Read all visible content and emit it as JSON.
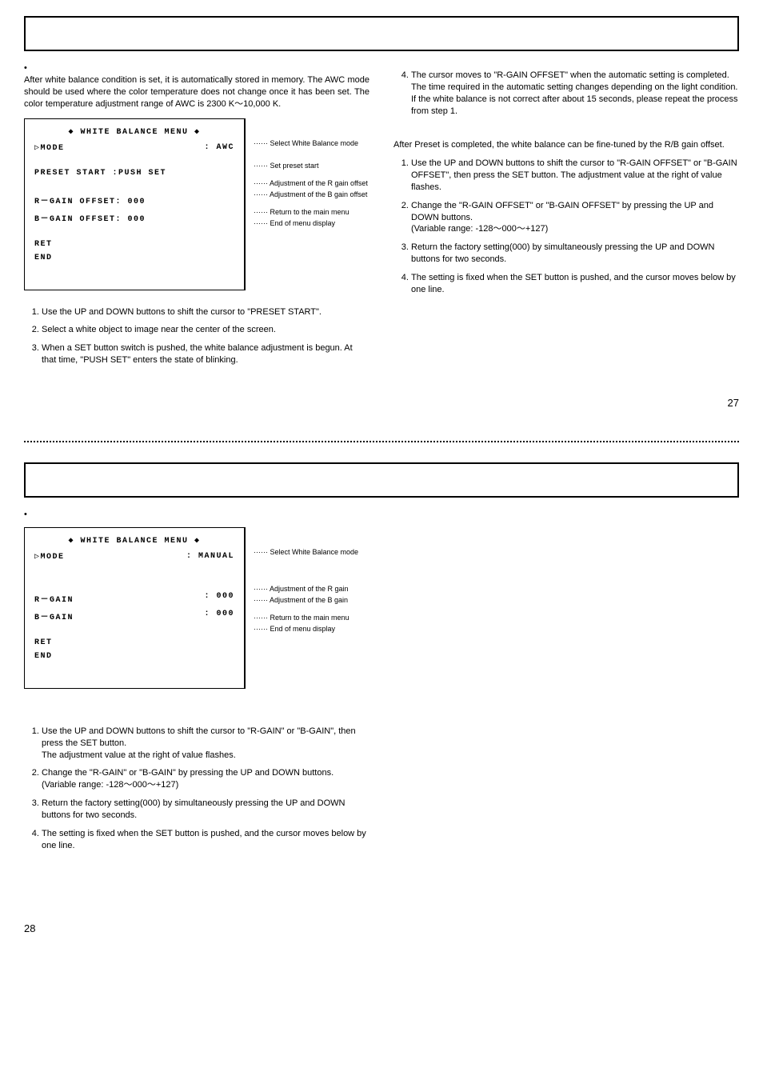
{
  "page27": {
    "left": {
      "intro_first_char": "•",
      "intro": "After white balance condition is set, it is automatically stored in memory.  The AWC mode should be used where the color temperature does not change once it has been set. The color temperature adjustment range of AWC is 2300 K～10,000 K.",
      "menu": {
        "title": "◆ WHITE BALANCE MENU ◆",
        "mode_label": "▷MODE",
        "mode_value": ": AWC",
        "preset_label": "PRESET START :PUSH SET",
        "rgain_label": "R－GAIN OFFSET: 000",
        "bgain_label": "B－GAIN OFFSET: 000",
        "ret": "RET",
        "end": "END"
      },
      "annot": {
        "a1": "Select White Balance mode",
        "a2": "Set preset start",
        "a3": "Adjustment of the R gain offset",
        "a4": "Adjustment of the B gain offset",
        "a5": "Return to the main menu",
        "a6": "End of menu display"
      },
      "steps": {
        "s1": "Use the UP and DOWN buttons to shift the cursor to \"PRESET START\".",
        "s2": "Select a white object to image near the center of the screen.",
        "s3": "When a SET button switch is pushed, the white balance adjustment is begun. At that time, \"PUSH SET\" enters the state of blinking."
      }
    },
    "right": {
      "step4": "The cursor moves to \"R-GAIN OFFSET\" when the automatic setting is completed. The time required in the automatic setting changes depending on the light condition.  If the white balance is not correct after about 15 seconds, please repeat the process from step 1.",
      "para2": "After Preset is completed, the white balance can be fine-tuned by the R/B gain offset.",
      "steps": {
        "s1": "Use the UP and DOWN buttons to shift the cursor to \"R-GAIN OFFSET\" or \"B-GAIN OFFSET\", then press the SET button. The adjustment value at the right of value flashes.",
        "s2": "Change the \"R-GAIN OFFSET\" or \"B-GAIN OFFSET\" by pressing the UP and DOWN buttons.\n(Variable range: -128～000～+127)",
        "s3": "Return the factory setting(000) by simultaneously pressing the UP and DOWN buttons for two seconds.",
        "s4": "The setting is fixed when the SET button is pushed, and the cursor moves below by one line."
      }
    },
    "pagenum": "27"
  },
  "page28": {
    "intro_first_char": "•",
    "menu": {
      "title": "◆ WHITE BALANCE MENU ◆",
      "mode_label": "▷MODE",
      "mode_value": ": MANUAL",
      "rgain_label": "R－GAIN",
      "rgain_value": ":  000",
      "bgain_label": "B－GAIN",
      "bgain_value": ":  000",
      "ret": "RET",
      "end": "END"
    },
    "annot": {
      "a1": "Select White Balance mode",
      "a3": "Adjustment of the R gain",
      "a4": "Adjustment of the B gain",
      "a5": "Return to the main menu",
      "a6": "End of menu display"
    },
    "steps": {
      "s1": "Use the UP and DOWN buttons to shift the cursor to \"R-GAIN\" or \"B-GAIN\", then press the SET button.\nThe adjustment value at the right of value flashes.",
      "s2": "Change the \"R-GAIN\" or \"B-GAIN\" by pressing the UP and DOWN buttons. (Variable range: -128～000～+127)",
      "s3": "Return the factory setting(000) by simultaneously pressing the UP and DOWN buttons for two seconds.",
      "s4": "The setting is fixed when the SET button is pushed, and the cursor moves below by one line."
    },
    "pagenum": "28"
  }
}
